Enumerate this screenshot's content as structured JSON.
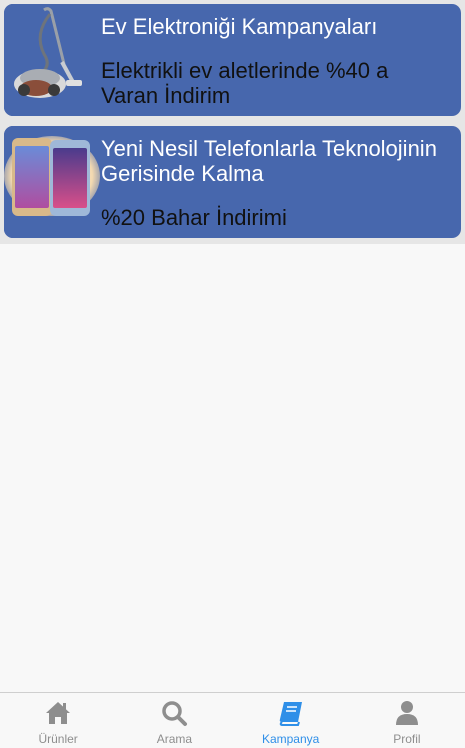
{
  "campaigns": [
    {
      "title": "Ev Elektroniği Kampanyaları",
      "subtitle": "Elektrikli ev aletlerinde %40 a Varan İndirim",
      "image_icon": "vacuum-cleaner-image"
    },
    {
      "title": "Yeni Nesil Telefonlarla Teknolojinin Gerisinde Kalma",
      "subtitle": "%20 Bahar İndirimi",
      "image_icon": "smartphones-image"
    }
  ],
  "tabbar": {
    "tabs": [
      {
        "label": "Ürünler",
        "icon": "home-icon",
        "active": false
      },
      {
        "label": "Arama",
        "icon": "search-icon",
        "active": false
      },
      {
        "label": "Kampanya",
        "icon": "book-icon",
        "active": true
      },
      {
        "label": "Profil",
        "icon": "user-icon",
        "active": false
      }
    ]
  },
  "colors": {
    "card_background": "#4767ad",
    "active_tab": "#2f8fe8",
    "inactive_tab": "#8e8e8e"
  }
}
